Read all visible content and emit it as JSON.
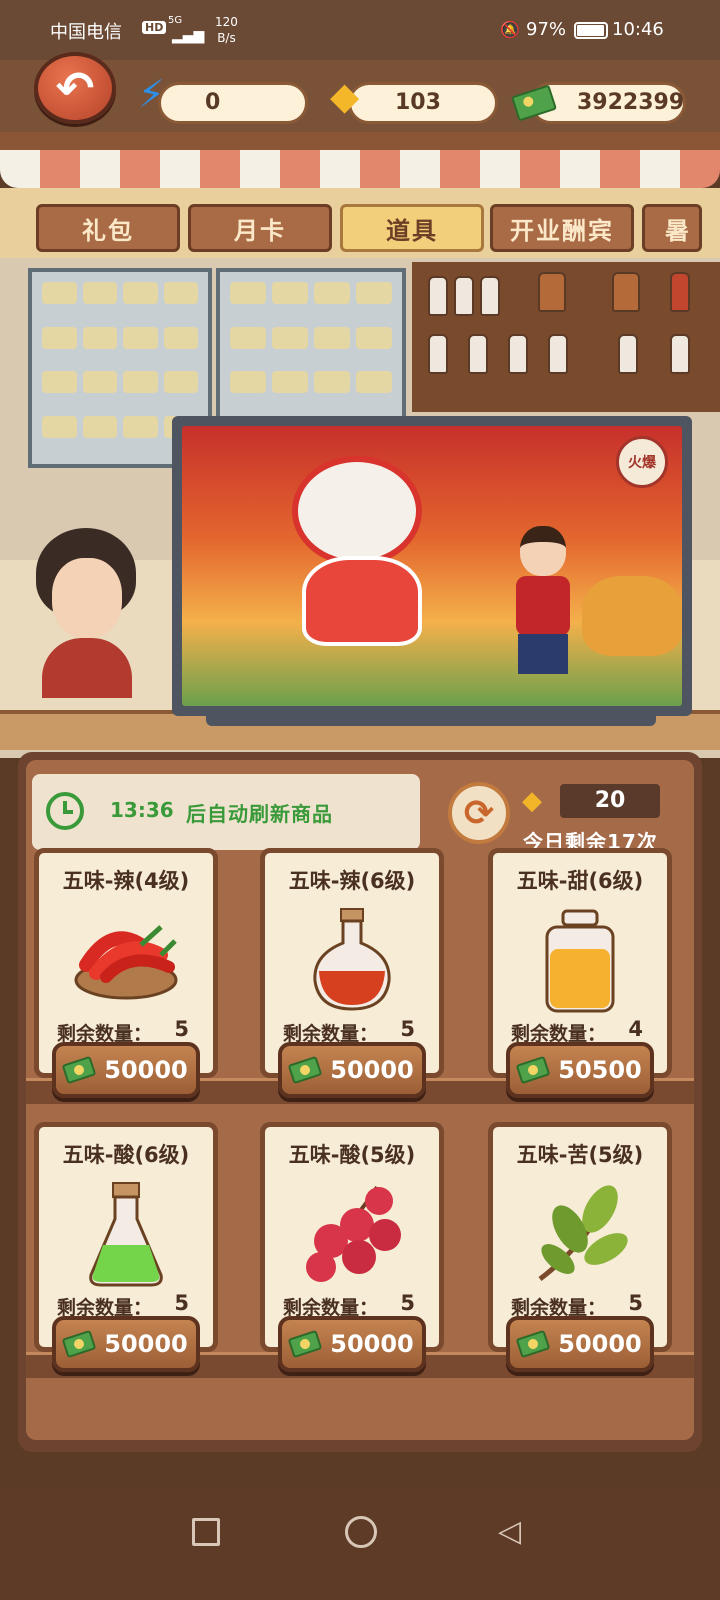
{
  "status_bar": {
    "carrier": "中国电信",
    "hd": "HD",
    "network": "5G",
    "speed_value": "120",
    "speed_unit": "B/s",
    "battery": "97%",
    "time": "10:46"
  },
  "resources": {
    "energy": "0",
    "gems": "103",
    "cash": "3922399"
  },
  "tabs": [
    {
      "label": "礼包",
      "active": false
    },
    {
      "label": "月卡",
      "active": false
    },
    {
      "label": "道具",
      "active": true
    },
    {
      "label": "开业酬宾",
      "active": false
    },
    {
      "label": "暑",
      "active": false
    }
  ],
  "tv": {
    "badge": "火爆"
  },
  "shop": {
    "refresh_time": "13:36",
    "refresh_text": "后自动刷新商品",
    "refresh_cost": "20",
    "remaining_today": "今日剩余17次"
  },
  "items": [
    {
      "name": "五味-辣(4级)",
      "count_label": "剩余数量：",
      "count": "5",
      "price": "50000",
      "icon": "chili-peppers-icon"
    },
    {
      "name": "五味-辣(6级)",
      "count_label": "剩余数量：",
      "count": "5",
      "price": "50000",
      "icon": "chili-oil-flask-icon"
    },
    {
      "name": "五味-甜(6级)",
      "count_label": "剩余数量：",
      "count": "4",
      "price": "50500",
      "icon": "honey-jar-icon"
    },
    {
      "name": "五味-酸(6级)",
      "count_label": "剩余数量：",
      "count": "5",
      "price": "50000",
      "icon": "green-potion-icon"
    },
    {
      "name": "五味-酸(5级)",
      "count_label": "剩余数量：",
      "count": "5",
      "price": "50000",
      "icon": "bayberry-icon"
    },
    {
      "name": "五味-苦(5级)",
      "count_label": "剩余数量：",
      "count": "5",
      "price": "50000",
      "icon": "tea-leaves-icon"
    }
  ],
  "colors": {
    "accent_green": "#3a9a3a",
    "tab_active": "#f2cf7b",
    "price_button": "#9c5f36"
  }
}
